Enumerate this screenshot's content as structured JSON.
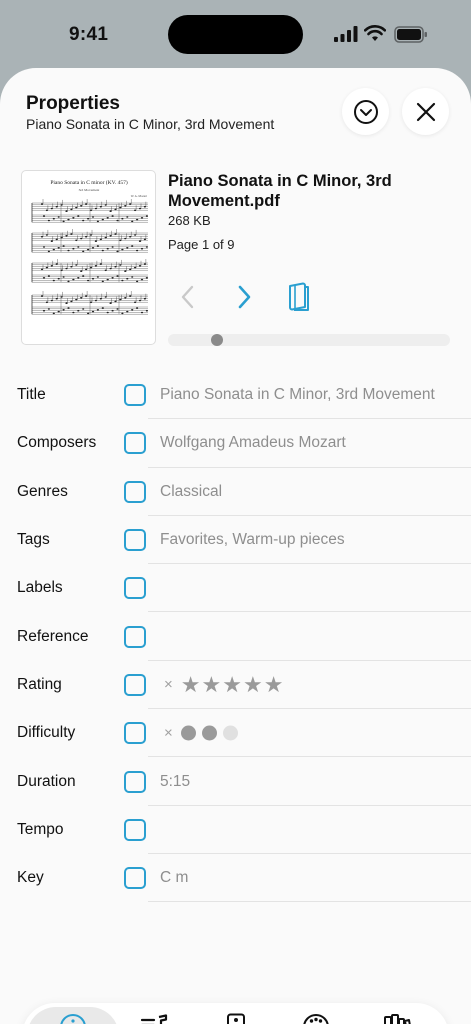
{
  "status_bar": {
    "time": "9:41"
  },
  "sheet": {
    "title": "Properties",
    "subtitle": "Piano Sonata in C Minor, 3rd Movement"
  },
  "file": {
    "name": "Piano Sonata in C Minor, 3rd Movement.pdf",
    "size": "268 KB",
    "page_info": "Page 1 of 9",
    "thumbnail_title": "Piano Sonata in C minor (KV. 457)",
    "thumbnail_subtitle": "3rd Movement",
    "thumbnail_composer": "W. A. Mozart",
    "current_page": 1,
    "total_pages": 9
  },
  "properties": [
    {
      "label": "Title",
      "value": "Piano Sonata in C Minor, 3rd Movement"
    },
    {
      "label": "Composers",
      "value": "Wolfgang Amadeus Mozart"
    },
    {
      "label": "Genres",
      "value": "Classical"
    },
    {
      "label": "Tags",
      "value": "Favorites, Warm-up pieces"
    },
    {
      "label": "Labels",
      "value": ""
    },
    {
      "label": "Reference",
      "value": ""
    },
    {
      "label": "Rating",
      "value": "",
      "rating": 5,
      "rating_max": 5,
      "clear_symbol": "×"
    },
    {
      "label": "Difficulty",
      "value": "",
      "difficulty": 2,
      "difficulty_max": 3,
      "clear_symbol": "×"
    },
    {
      "label": "Duration",
      "value": "5:15"
    },
    {
      "label": "Tempo",
      "value": ""
    },
    {
      "label": "Key",
      "value": "C m"
    }
  ],
  "tabs": [
    {
      "label": "Properties",
      "icon": "info-icon",
      "active": true
    },
    {
      "label": "Setlists",
      "icon": "setlist-icon",
      "active": false
    },
    {
      "label": "Audio",
      "icon": "speaker-icon",
      "active": false
    },
    {
      "label": "MIDI",
      "icon": "midi-icon",
      "active": false
    },
    {
      "label": "Libraries",
      "icon": "books-icon",
      "active": false
    }
  ],
  "colors": {
    "accent": "#2a9fd0",
    "star": "#9a9a9a",
    "dot_filled": "#9a9a9a",
    "dot_empty": "#e0e0e0"
  }
}
